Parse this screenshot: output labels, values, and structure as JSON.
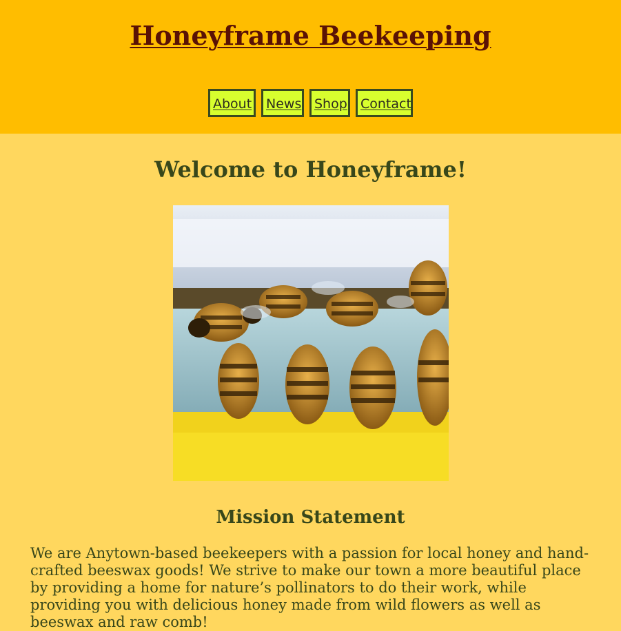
{
  "header": {
    "site_title": "Honeyframe Beekeeping",
    "nav": [
      {
        "label": "About"
      },
      {
        "label": "News"
      },
      {
        "label": "Shop"
      },
      {
        "label": "Contact"
      }
    ]
  },
  "main": {
    "welcome_heading": "Welcome to Honeyframe!",
    "hero_image": {
      "icon": "bees-on-hive-photo"
    },
    "mission": {
      "heading": "Mission Statement",
      "text": "We are Anytown-based beekeepers with a passion for local honey and hand-crafted beeswax goods! We strive to make our town a more beautiful place by providing a home for nature’s pollinators to do their work, while providing you with delicious honey made from wild flowers as well as beeswax and raw comb!"
    }
  },
  "colors": {
    "header_bg": "#ffbd00",
    "page_bg": "#ffd75e",
    "title_color": "#5a1205",
    "heading_color": "#38471a",
    "nav_bg": "#d8ff2e",
    "nav_border": "#3a4a1f"
  }
}
